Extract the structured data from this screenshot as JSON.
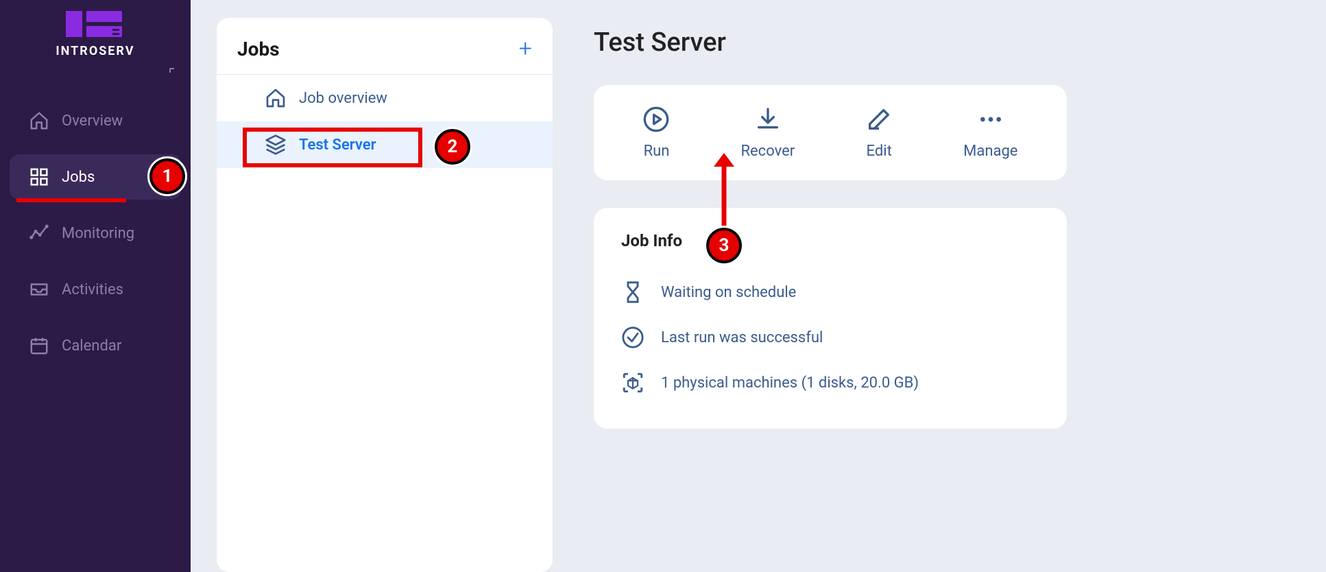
{
  "brand": {
    "name": "INTROSERV"
  },
  "sidebar": {
    "items": [
      {
        "label": "Overview"
      },
      {
        "label": "Jobs"
      },
      {
        "label": "Monitoring"
      },
      {
        "label": "Activities"
      },
      {
        "label": "Calendar"
      }
    ]
  },
  "jobs_panel": {
    "title": "Jobs",
    "items": [
      {
        "label": "Job overview"
      },
      {
        "label": "Test Server"
      }
    ]
  },
  "detail": {
    "title": "Test Server",
    "actions": {
      "run": "Run",
      "recover": "Recover",
      "edit": "Edit",
      "manage": "Manage"
    },
    "info": {
      "heading": "Job Info",
      "status": "Waiting on schedule",
      "last_run": "Last run was successful",
      "machines": "1 physical machines (1 disks, 20.0 GB)"
    }
  },
  "annotations": {
    "one": "1",
    "two": "2",
    "three": "3"
  }
}
